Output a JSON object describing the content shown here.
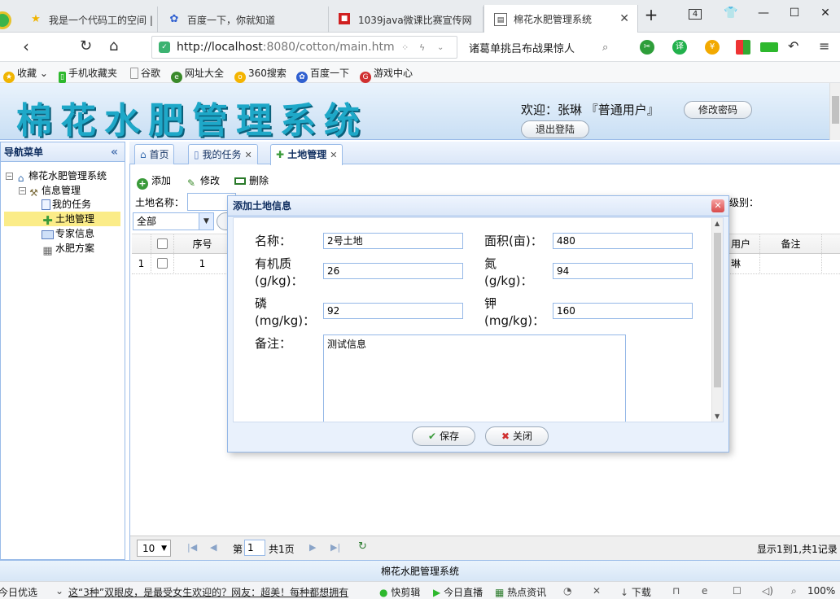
{
  "browser": {
    "tabs": [
      {
        "title": "我是一个代码工的空间 |",
        "icon": "star-icon"
      },
      {
        "title": "百度一下，你就知道",
        "icon": "paw-icon"
      },
      {
        "title": "1039java微课比赛宣传网",
        "icon": "red-square-icon"
      },
      {
        "title": "棉花水肥管理系统",
        "icon": "page-icon"
      }
    ],
    "tab_count": "4",
    "url_host": "http://localhost",
    "url_rest": ":8080/cotton/main.htm",
    "search_text": "诸葛单挑吕布战果惊人",
    "bookmarks": [
      "收藏",
      "手机收藏夹",
      "谷歌",
      "网址大全",
      "360搜索",
      "百度一下",
      "游戏中心"
    ]
  },
  "app": {
    "title": "棉花水肥管理系统",
    "welcome": "欢迎：张琳 『普通用户』",
    "change_password": "修改密码",
    "logout": "退出登陆",
    "footer": "棉花水肥管理系统"
  },
  "nav": {
    "title": "导航菜单",
    "collapse": "«",
    "root": "棉花水肥管理系统",
    "group": "信息管理",
    "items": [
      "我的任务",
      "土地管理",
      "专家信息",
      "水肥方案"
    ]
  },
  "center_tabs": [
    {
      "label": "首页",
      "closable": false
    },
    {
      "label": "我的任务",
      "closable": true
    },
    {
      "label": "土地管理",
      "closable": true
    }
  ],
  "toolbar": {
    "add": "添加",
    "edit": "修改",
    "delete": "删除"
  },
  "filter": {
    "land_name_label": "土地名称：",
    "level_label": "级别：",
    "select_value": "全部"
  },
  "grid": {
    "headers": {
      "seq": "序号",
      "user": "用户",
      "remark": "备注"
    },
    "rows": [
      {
        "rownum": "1",
        "seq": "1",
        "user": "琳"
      }
    ]
  },
  "pager": {
    "page_size": "10",
    "page_prefix": "第",
    "page_value": "1",
    "page_suffix": "共1页",
    "summary": "显示1到1,共1记录"
  },
  "dialog": {
    "title": "添加土地信息",
    "fields": {
      "name_label": "名称：",
      "name_value": "2号土地",
      "area_label": "面积(亩)：",
      "area_value": "480",
      "organic_label_1": "有机质",
      "organic_label_2": "(g/kg)：",
      "organic_value": "26",
      "nitrogen_label_1": "氮",
      "nitrogen_label_2": "(g/kg)：",
      "nitrogen_value": "94",
      "phosphorus_label_1": "磷",
      "phosphorus_label_2": "(mg/kg)：",
      "phosphorus_value": "92",
      "potassium_label_1": "钾",
      "potassium_label_2": "(mg/kg)：",
      "potassium_value": "160",
      "remark_label": "备注：",
      "remark_value": "测试信息"
    },
    "save": "保存",
    "close": "关闭"
  },
  "status": {
    "left": "今日优选",
    "news": "这“3种”双眼皮，是最受女生欢迎的？网友：超美！每种都想拥有",
    "items": [
      "快剪辑",
      "今日直播",
      "热点资讯",
      "下载"
    ],
    "zoom": "100%"
  },
  "colors": {
    "accent": "#99bbe8",
    "logo": "#1ea8c8",
    "selected": "#fbec88"
  }
}
